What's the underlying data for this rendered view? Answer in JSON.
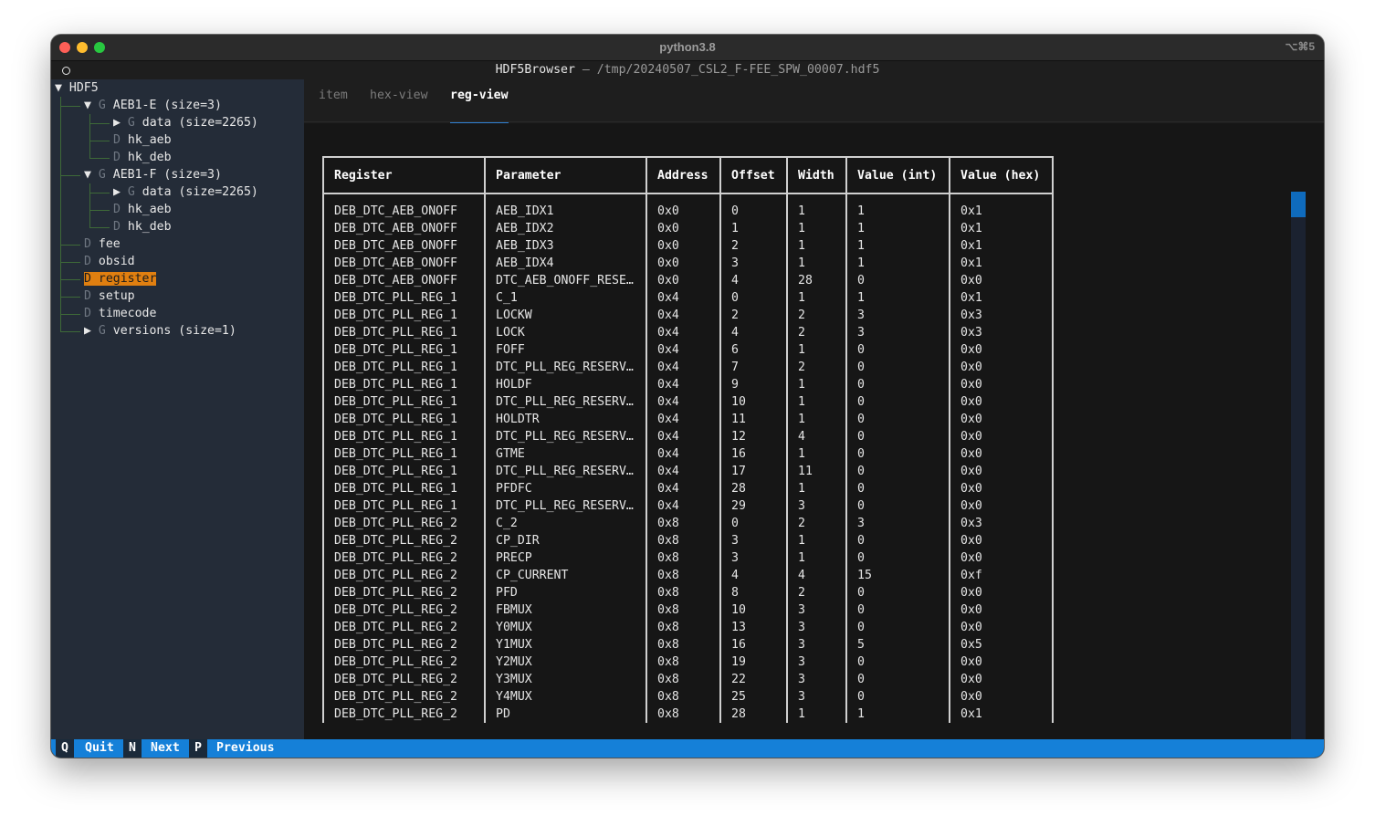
{
  "window": {
    "title": "python3.8",
    "shortcut": "⌥⌘5"
  },
  "header": {
    "app": "HDF5Browser",
    "separator": " — ",
    "path": "/tmp/20240507_CSL2_F-FEE_SPW_00007.hdf5"
  },
  "tree": {
    "root": "HDF5",
    "items": [
      {
        "kind": "G",
        "label": "AEB1-E (size=3)",
        "expanded": true
      },
      {
        "kind": "G",
        "label": "data (size=2265)",
        "expanded": false
      },
      {
        "kind": "D",
        "label": "hk_aeb"
      },
      {
        "kind": "D",
        "label": "hk_deb"
      },
      {
        "kind": "G",
        "label": "AEB1-F (size=3)",
        "expanded": true
      },
      {
        "kind": "G",
        "label": "data (size=2265)",
        "expanded": false
      },
      {
        "kind": "D",
        "label": "hk_aeb"
      },
      {
        "kind": "D",
        "label": "hk_deb"
      },
      {
        "kind": "D",
        "label": "fee"
      },
      {
        "kind": "D",
        "label": "obsid"
      },
      {
        "kind": "D",
        "label": "register",
        "selected": true
      },
      {
        "kind": "D",
        "label": "setup"
      },
      {
        "kind": "D",
        "label": "timecode"
      },
      {
        "kind": "G",
        "label": "versions (size=1)",
        "expanded": false
      }
    ]
  },
  "tabs": [
    {
      "label": "item"
    },
    {
      "label": "hex-view"
    },
    {
      "label": "reg-view",
      "active": true
    }
  ],
  "table": {
    "columns": [
      "Register",
      "Parameter",
      "Address",
      "Offset",
      "Width",
      "Value (int)",
      "Value (hex)"
    ],
    "rows": [
      [
        "DEB_DTC_AEB_ONOFF",
        "AEB_IDX1",
        "0x0",
        "0",
        "1",
        "1",
        "0x1"
      ],
      [
        "DEB_DTC_AEB_ONOFF",
        "AEB_IDX2",
        "0x0",
        "1",
        "1",
        "1",
        "0x1"
      ],
      [
        "DEB_DTC_AEB_ONOFF",
        "AEB_IDX3",
        "0x0",
        "2",
        "1",
        "1",
        "0x1"
      ],
      [
        "DEB_DTC_AEB_ONOFF",
        "AEB_IDX4",
        "0x0",
        "3",
        "1",
        "1",
        "0x1"
      ],
      [
        "DEB_DTC_AEB_ONOFF",
        "DTC_AEB_ONOFF_RESE…",
        "0x0",
        "4",
        "28",
        "0",
        "0x0"
      ],
      [
        "DEB_DTC_PLL_REG_1",
        "C_1",
        "0x4",
        "0",
        "1",
        "1",
        "0x1"
      ],
      [
        "DEB_DTC_PLL_REG_1",
        "LOCKW",
        "0x4",
        "2",
        "2",
        "3",
        "0x3"
      ],
      [
        "DEB_DTC_PLL_REG_1",
        "LOCK",
        "0x4",
        "4",
        "2",
        "3",
        "0x3"
      ],
      [
        "DEB_DTC_PLL_REG_1",
        "FOFF",
        "0x4",
        "6",
        "1",
        "0",
        "0x0"
      ],
      [
        "DEB_DTC_PLL_REG_1",
        "DTC_PLL_REG_RESERV…",
        "0x4",
        "7",
        "2",
        "0",
        "0x0"
      ],
      [
        "DEB_DTC_PLL_REG_1",
        "HOLDF",
        "0x4",
        "9",
        "1",
        "0",
        "0x0"
      ],
      [
        "DEB_DTC_PLL_REG_1",
        "DTC_PLL_REG_RESERV…",
        "0x4",
        "10",
        "1",
        "0",
        "0x0"
      ],
      [
        "DEB_DTC_PLL_REG_1",
        "HOLDTR",
        "0x4",
        "11",
        "1",
        "0",
        "0x0"
      ],
      [
        "DEB_DTC_PLL_REG_1",
        "DTC_PLL_REG_RESERV…",
        "0x4",
        "12",
        "4",
        "0",
        "0x0"
      ],
      [
        "DEB_DTC_PLL_REG_1",
        "GTME",
        "0x4",
        "16",
        "1",
        "0",
        "0x0"
      ],
      [
        "DEB_DTC_PLL_REG_1",
        "DTC_PLL_REG_RESERV…",
        "0x4",
        "17",
        "11",
        "0",
        "0x0"
      ],
      [
        "DEB_DTC_PLL_REG_1",
        "PFDFC",
        "0x4",
        "28",
        "1",
        "0",
        "0x0"
      ],
      [
        "DEB_DTC_PLL_REG_1",
        "DTC_PLL_REG_RESERV…",
        "0x4",
        "29",
        "3",
        "0",
        "0x0"
      ],
      [
        "DEB_DTC_PLL_REG_2",
        "C_2",
        "0x8",
        "0",
        "2",
        "3",
        "0x3"
      ],
      [
        "DEB_DTC_PLL_REG_2",
        "CP_DIR",
        "0x8",
        "3",
        "1",
        "0",
        "0x0"
      ],
      [
        "DEB_DTC_PLL_REG_2",
        "PRECP",
        "0x8",
        "3",
        "1",
        "0",
        "0x0"
      ],
      [
        "DEB_DTC_PLL_REG_2",
        "CP_CURRENT",
        "0x8",
        "4",
        "4",
        "15",
        "0xf"
      ],
      [
        "DEB_DTC_PLL_REG_2",
        "PFD",
        "0x8",
        "8",
        "2",
        "0",
        "0x0"
      ],
      [
        "DEB_DTC_PLL_REG_2",
        "FBMUX",
        "0x8",
        "10",
        "3",
        "0",
        "0x0"
      ],
      [
        "DEB_DTC_PLL_REG_2",
        "Y0MUX",
        "0x8",
        "13",
        "3",
        "0",
        "0x0"
      ],
      [
        "DEB_DTC_PLL_REG_2",
        "Y1MUX",
        "0x8",
        "16",
        "3",
        "5",
        "0x5"
      ],
      [
        "DEB_DTC_PLL_REG_2",
        "Y2MUX",
        "0x8",
        "19",
        "3",
        "0",
        "0x0"
      ],
      [
        "DEB_DTC_PLL_REG_2",
        "Y3MUX",
        "0x8",
        "22",
        "3",
        "0",
        "0x0"
      ],
      [
        "DEB_DTC_PLL_REG_2",
        "Y4MUX",
        "0x8",
        "25",
        "3",
        "0",
        "0x0"
      ],
      [
        "DEB_DTC_PLL_REG_2",
        "PD",
        "0x8",
        "28",
        "1",
        "1",
        "0x1"
      ]
    ]
  },
  "footer": {
    "bindings": [
      {
        "key": "Q",
        "label": "Quit"
      },
      {
        "key": "N",
        "label": "Next"
      },
      {
        "key": "P",
        "label": "Previous"
      }
    ]
  },
  "colors": {
    "accent": "#1580d8",
    "selection": "#e07f10",
    "sidebar_bg": "#242c38",
    "tree_guides": "#3e6a38"
  },
  "icons": {
    "expanded": "down-triangle-icon",
    "collapsed": "right-triangle-icon",
    "status": "circle-icon"
  }
}
